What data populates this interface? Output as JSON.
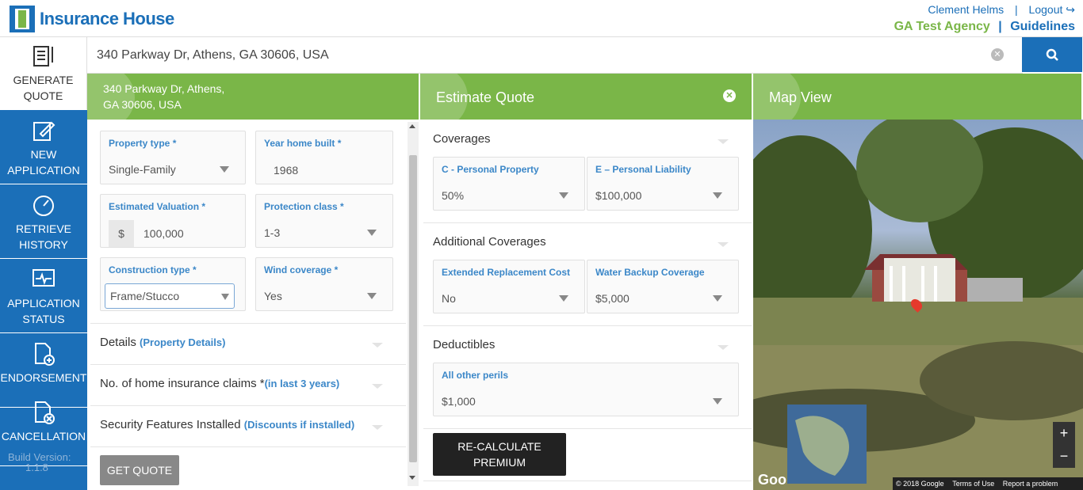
{
  "header": {
    "brand": "Insurance House",
    "user": "Clement Helms",
    "separator": "|",
    "logout": "Logout",
    "agency": "GA Test Agency",
    "guidelines": "Guidelines"
  },
  "sidebar": {
    "items": [
      {
        "label": "GENERATE QUOTE",
        "icon": "document-pen-icon"
      },
      {
        "label": "NEW APPLICATION",
        "icon": "edit-icon"
      },
      {
        "label": "RETRIEVE HISTORY",
        "icon": "history-icon"
      },
      {
        "label": "APPLICATION STATUS",
        "icon": "status-monitor-icon"
      },
      {
        "label": "ENDORSEMENT",
        "icon": "document-add-icon"
      },
      {
        "label": "CANCELLATION",
        "icon": "document-cancel-icon"
      }
    ],
    "build": "Build Version:",
    "build_value": "1.1.8"
  },
  "search": {
    "value": "340 Parkway Dr, Athens, GA 30606, USA"
  },
  "property_panel": {
    "address_line1": "340 Parkway Dr, Athens,",
    "address_line2": "GA 30606, USA",
    "fields": {
      "property_type": {
        "label": "Property type *",
        "value": "Single-Family"
      },
      "year_built": {
        "label": "Year home built *",
        "value": "1968"
      },
      "valuation": {
        "label": "Estimated Valuation *",
        "prefix": "$",
        "value": "100,000"
      },
      "protection_class": {
        "label": "Protection class *",
        "value": "1-3"
      },
      "construction_type": {
        "label": "Construction type *",
        "value": "Frame/Stucco"
      },
      "wind_coverage": {
        "label": "Wind coverage *",
        "value": "Yes"
      }
    },
    "sections": {
      "details": "Details",
      "details_hint": "(Property Details)",
      "claims": "No. of home insurance claims *",
      "claims_hint": "(in last 3 years)",
      "security": "Security Features Installed",
      "security_hint": "(Discounts if installed)"
    },
    "get_quote": "GET QUOTE"
  },
  "estimate_panel": {
    "title": "Estimate Quote",
    "coverages": "Coverages",
    "personal_property": {
      "label": "C - Personal Property",
      "value": "50%"
    },
    "personal_liability": {
      "label": "E – Personal Liability",
      "value": "$100,000"
    },
    "additional": "Additional Coverages",
    "replacement": {
      "label": "Extended Replacement Cost",
      "value": "No"
    },
    "water_backup": {
      "label": "Water Backup Coverage",
      "value": "$5,000"
    },
    "deductibles": "Deductibles",
    "all_perils": {
      "label": "All other perils",
      "value": "$1,000"
    },
    "recalc": "RE-CALCULATE PREMIUM"
  },
  "map_panel": {
    "title": "Map View",
    "google": "Goo",
    "copyright": "© 2018 Google",
    "terms": "Terms of Use",
    "report": "Report a problem",
    "zoom_in": "+",
    "zoom_out": "−"
  }
}
